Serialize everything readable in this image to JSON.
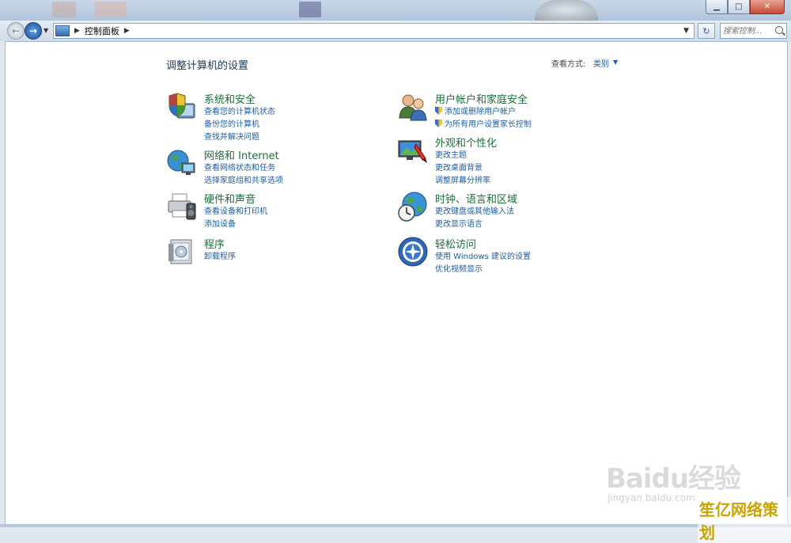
{
  "window": {
    "min_label": "▁",
    "max_label": "□",
    "close_label": "✕"
  },
  "nav": {
    "address_text": "控制面板",
    "search_placeholder": "搜索控制...",
    "refresh_label": "↻"
  },
  "page": {
    "title": "调整计算机的设置",
    "viewby_label": "查看方式:",
    "viewby_value": "类别"
  },
  "categories": [
    {
      "icon": "shield-monitor-icon",
      "title": "系统和安全",
      "links": [
        "查看您的计算机状态",
        "备份您的计算机",
        "查找并解决问题"
      ]
    },
    {
      "icon": "network-globe-icon",
      "title": "网络和 Internet",
      "links": [
        "查看网络状态和任务",
        "选择家庭组和共享选项"
      ]
    },
    {
      "icon": "printer-speaker-icon",
      "title": "硬件和声音",
      "links": [
        "查看设备和打印机",
        "添加设备"
      ]
    },
    {
      "icon": "programs-icon",
      "title": "程序",
      "links": [
        "卸载程序"
      ]
    },
    {
      "icon": "users-icon",
      "title": "用户帐户和家庭安全",
      "links": [
        "添加或删除用户帐户",
        "为所有用户设置家长控制"
      ]
    },
    {
      "icon": "appearance-icon",
      "title": "外观和个性化",
      "links": [
        "更改主题",
        "更改桌面背景",
        "调整屏幕分辨率"
      ]
    },
    {
      "icon": "clock-globe-icon",
      "title": "时钟、语言和区域",
      "links": [
        "更改键盘或其他输入法",
        "更改显示语言"
      ]
    },
    {
      "icon": "ease-of-access-icon",
      "title": "轻松访问",
      "links": [
        "使用 Windows 建议的设置",
        "优化视频显示"
      ]
    }
  ],
  "watermark": {
    "logo": "Baidu经验",
    "url": "jingyan.baidu.com",
    "text": "笙亿网络策划"
  }
}
